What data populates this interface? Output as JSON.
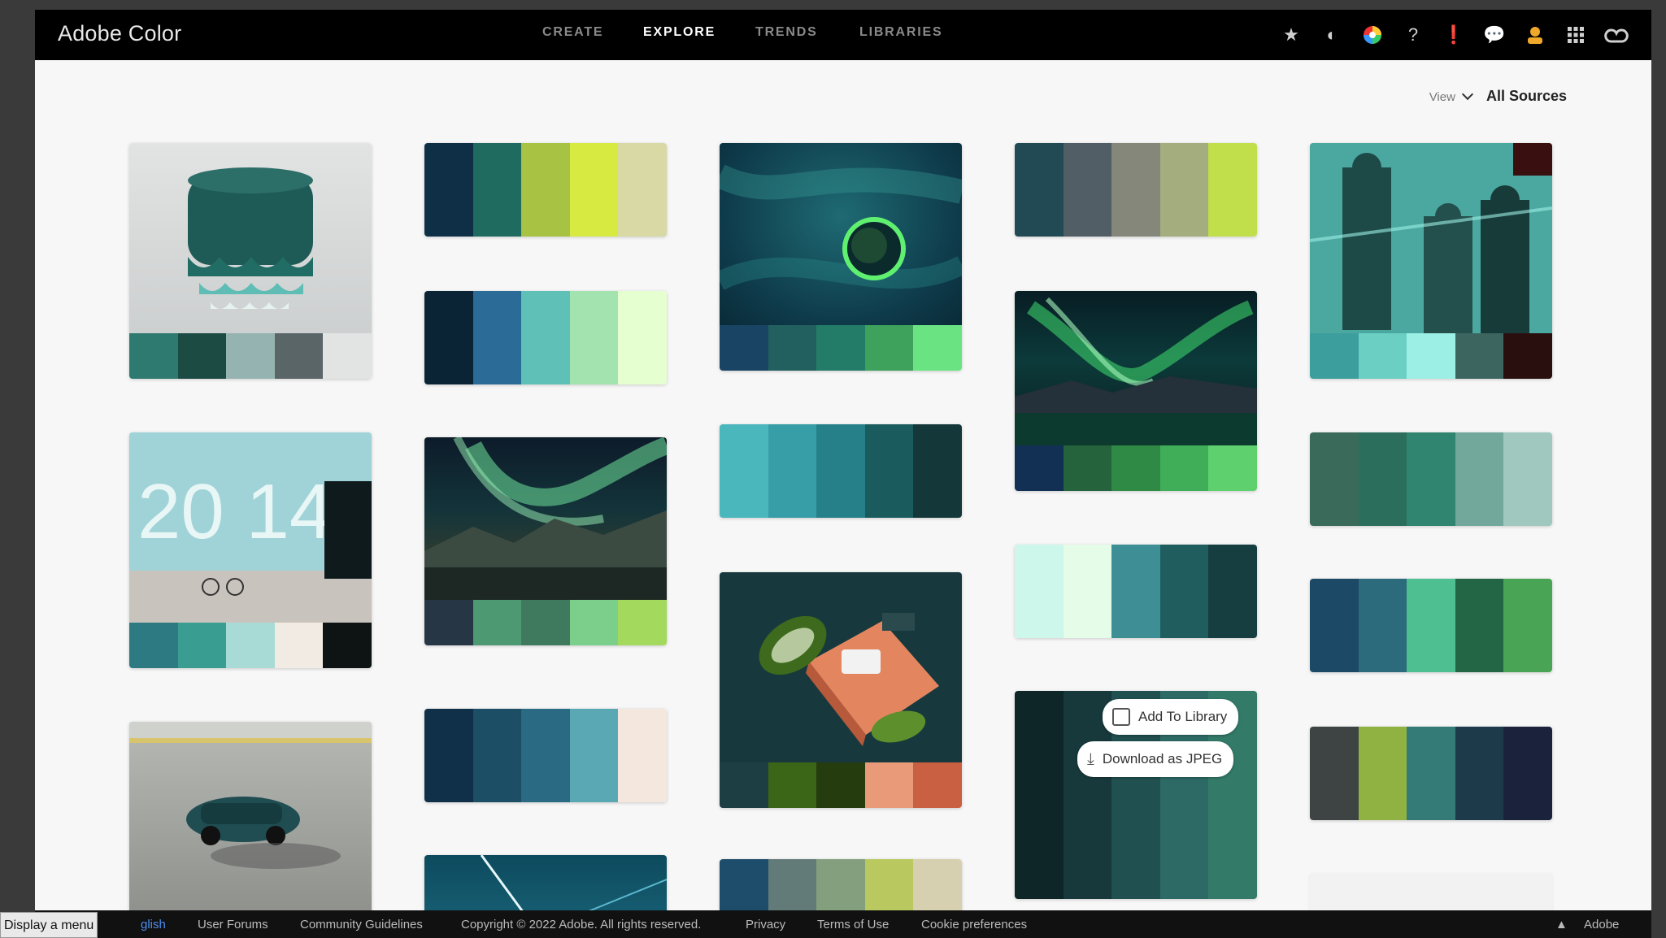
{
  "app": {
    "title": "Adobe Color"
  },
  "nav": {
    "items": [
      {
        "label": "CREATE"
      },
      {
        "label": "EXPLORE"
      },
      {
        "label": "TRENDS"
      },
      {
        "label": "LIBRARIES"
      }
    ],
    "active": "EXPLORE"
  },
  "toolbar": {
    "icons": [
      "star-icon",
      "contrast-icon",
      "color-wheel-icon",
      "help-icon",
      "feedback-icon",
      "chat-icon",
      "user-avatar-icon",
      "apps-grid-icon",
      "creative-cloud-icon"
    ]
  },
  "view": {
    "label": "View",
    "sources": "All Sources"
  },
  "overlay": {
    "add": "Add To Library",
    "download": "Download as JPEG"
  },
  "footer": {
    "tooltip": "Display a menu",
    "english": "glish",
    "links": [
      "User Forums",
      "Community Guidelines",
      "Copyright © 2022 Adobe. All rights reserved.",
      "Privacy",
      "Terms of Use",
      "Cookie preferences"
    ],
    "brand": "Adobe"
  },
  "cards": [
    {
      "id": "c1",
      "kind": "image",
      "colors": [
        "#2e7a70",
        "#1c4b44",
        "#95b3b0",
        "#5a6568"
      ]
    },
    {
      "id": "c2",
      "kind": "palette",
      "colors": [
        "#0f2f47",
        "#1f6b60",
        "#a8c244",
        "#d6ea42",
        "#d8d9a4"
      ]
    },
    {
      "id": "c3",
      "kind": "palette",
      "colors": [
        "#0a2436",
        "#2b6b97",
        "#5fc0b8",
        "#a3e3b0",
        "#e6ffd0"
      ]
    },
    {
      "id": "c4",
      "kind": "image",
      "colors": [
        "#194463",
        "#22605f",
        "#237c68",
        "#3ea25c",
        "#6ae483"
      ]
    },
    {
      "id": "c5",
      "kind": "palette",
      "colors": [
        "#4ab7bd",
        "#379da6",
        "#26808a",
        "#1a5c5e",
        "#14383a"
      ]
    },
    {
      "id": "c6",
      "kind": "palette",
      "colors": [
        "#214a55",
        "#515e66",
        "#84877a",
        "#a3ad7d",
        "#c0df4a"
      ]
    },
    {
      "id": "c7",
      "kind": "image",
      "colors": [
        "#123054",
        "#24633c",
        "#2f8a45",
        "#40ad58",
        "#5ed16e"
      ]
    },
    {
      "id": "c8",
      "kind": "palette",
      "colors": [
        "#ccf7ea",
        "#e5fce9",
        "#3d8f95",
        "#1f5d5e",
        "#163d40"
      ]
    },
    {
      "id": "c9",
      "kind": "palette",
      "colors": [
        "#0f2628",
        "#17393c",
        "#20504f",
        "#2d6a66",
        "#337a68"
      ]
    },
    {
      "id": "c10",
      "kind": "image",
      "colors": [
        "#3c9e9d",
        "#6bcfc4",
        "#9cefe5",
        "#3c6560",
        "#2a0f0f"
      ]
    },
    {
      "id": "c11",
      "kind": "palette",
      "colors": [
        "#3a6b5a",
        "#2b6e5c",
        "#2f8570",
        "#72a89b",
        "#a0c8bf"
      ]
    },
    {
      "id": "c12",
      "kind": "palette",
      "colors": [
        "#1c4966",
        "#2b6b7c",
        "#4dbf90",
        "#236645",
        "#4aa455"
      ]
    },
    {
      "id": "c13",
      "kind": "palette",
      "colors": [
        "#3d4443",
        "#8fb243",
        "#347a76",
        "#1c3a49",
        "#1b223b"
      ]
    },
    {
      "id": "c14",
      "kind": "image",
      "colors": [
        "#2e7a83",
        "#3a9d92",
        "#a8dad6",
        "#f2ebe3",
        "#0e1314"
      ]
    },
    {
      "id": "c15",
      "kind": "image",
      "colors": [
        "#263645",
        "#4d9a72",
        "#3f7a5f",
        "#7bcf8a",
        "#a3d95c"
      ]
    },
    {
      "id": "c16",
      "kind": "palette",
      "colors": [
        "#10304a",
        "#1c4e66",
        "#2a6a82",
        "#5aa8b3",
        "#f3e7de"
      ]
    },
    {
      "id": "c17",
      "kind": "image",
      "colors": [
        "#1d3e43",
        "#3b6618",
        "#253d0e",
        "#e99a78",
        "#c96042"
      ]
    },
    {
      "id": "c18",
      "kind": "palette",
      "colors": [
        "#1d4d6b",
        "#627a78",
        "#849f7e",
        "#b9c95f",
        "#d6d0b0"
      ]
    },
    {
      "id": "c19",
      "kind": "image",
      "colors": []
    },
    {
      "id": "c20",
      "kind": "image",
      "colors": []
    }
  ]
}
